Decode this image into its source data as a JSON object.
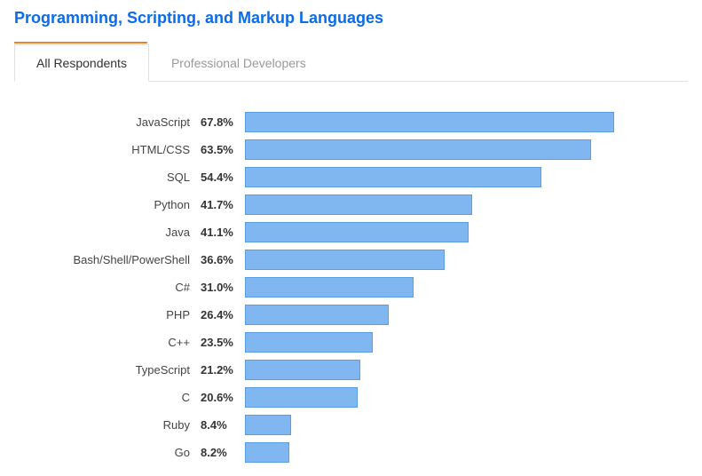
{
  "title": "Programming, Scripting, and Markup Languages",
  "tabs": [
    "All Respondents",
    "Professional Developers"
  ],
  "active_tab": 0,
  "chart_data": {
    "type": "bar",
    "orientation": "horizontal",
    "title": "Programming, Scripting, and Markup Languages",
    "xlabel": "",
    "ylabel": "",
    "xlim": [
      0,
      100
    ],
    "categories": [
      "JavaScript",
      "HTML/CSS",
      "SQL",
      "Python",
      "Java",
      "Bash/Shell/PowerShell",
      "C#",
      "PHP",
      "C++",
      "TypeScript",
      "C",
      "Ruby",
      "Go"
    ],
    "values": [
      67.8,
      63.5,
      54.4,
      41.7,
      41.1,
      36.6,
      31.0,
      26.4,
      23.5,
      21.2,
      20.6,
      8.4,
      8.2
    ],
    "value_labels": [
      "67.8%",
      "63.5%",
      "54.4%",
      "41.7%",
      "41.1%",
      "36.6%",
      "31.0%",
      "26.4%",
      "23.5%",
      "21.2%",
      "20.6%",
      "8.4%",
      "8.2%"
    ],
    "max_scale": 70
  }
}
